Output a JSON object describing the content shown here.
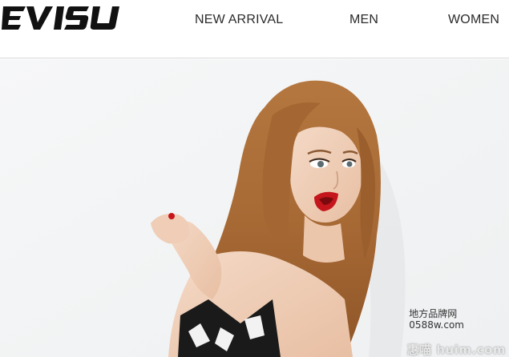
{
  "header": {
    "logo_text": "EVISU",
    "nav": [
      {
        "label": "NEW ARRIVAL"
      },
      {
        "label": "MEN"
      },
      {
        "label": "WOMEN"
      }
    ]
  },
  "hero": {
    "image": "fashion-model-photo"
  },
  "watermarks": {
    "line1": "地方品牌网",
    "line2": "0588w.com",
    "line3": "惠喵 huim.com"
  }
}
